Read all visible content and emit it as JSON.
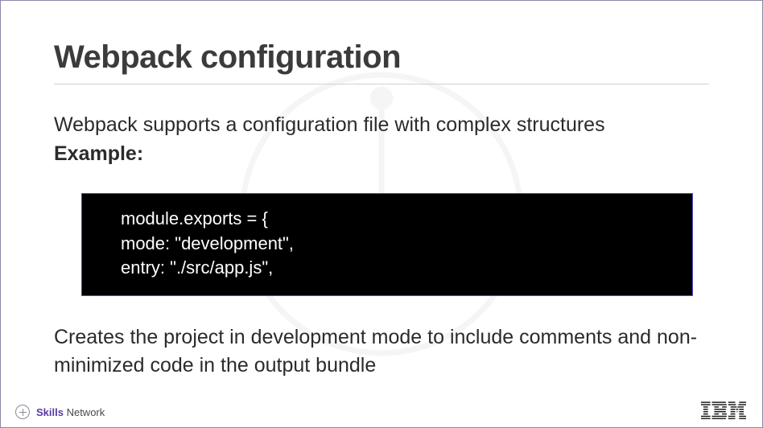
{
  "title": "Webpack configuration",
  "intro": "Webpack supports a configuration file with complex structures",
  "exampleLabel": "Example:",
  "code": {
    "line1": "module.exports = {",
    "line2": "mode: \"development\",",
    "line3": "entry: \"./src/app.js\","
  },
  "description": "Creates the project in development mode to include comments and non-minimized code in the output bundle",
  "footer": {
    "skillsBold": "Skills",
    "skillsRest": " Network",
    "brand": "IBM"
  }
}
